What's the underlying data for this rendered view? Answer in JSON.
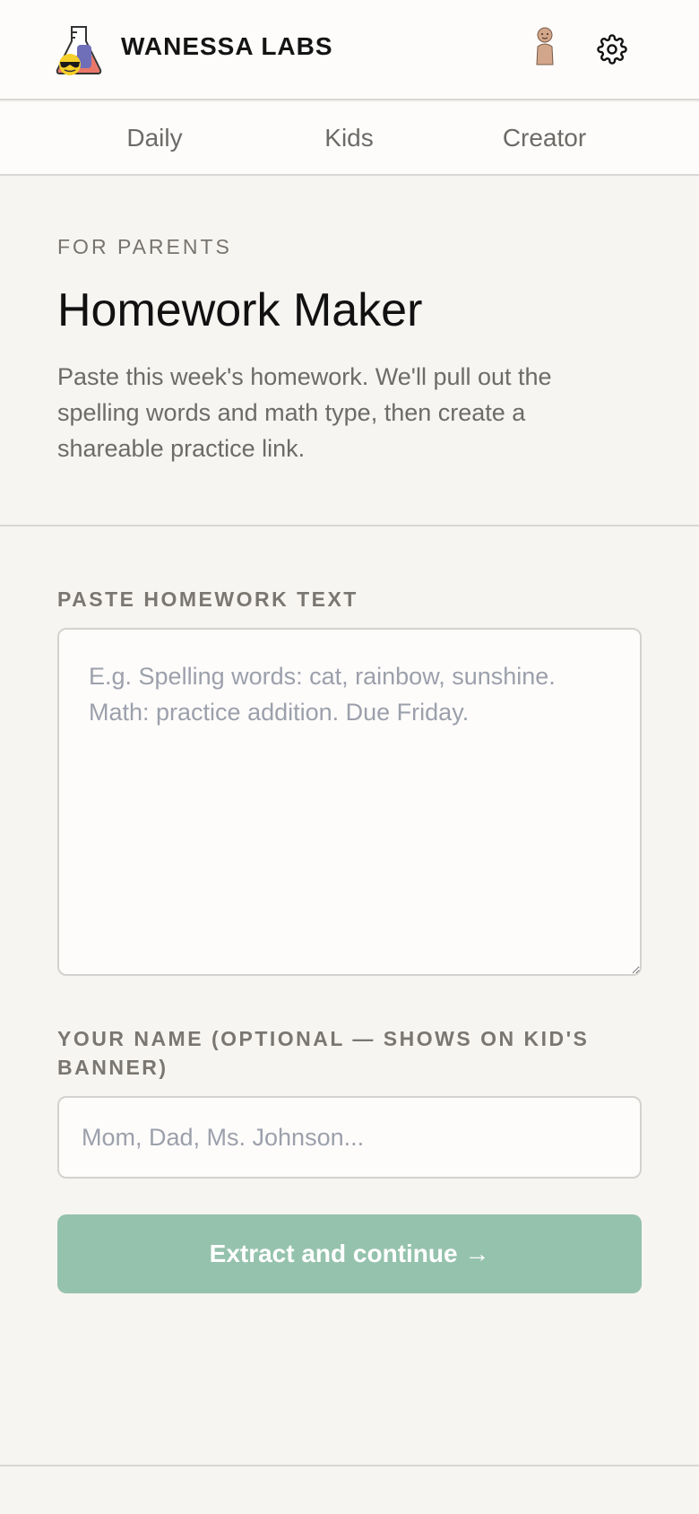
{
  "header": {
    "brand": "WANESSA LABS",
    "logo_icon": "flask-with-cool-emoji-icon",
    "avatar_icon": "person-avatar-icon",
    "settings_icon": "gear-icon"
  },
  "nav": {
    "items": [
      {
        "label": "Daily"
      },
      {
        "label": "Kids"
      },
      {
        "label": "Creator"
      }
    ]
  },
  "intro": {
    "eyebrow": "FOR PARENTS",
    "title": "Homework Maker",
    "description": "Paste this week's homework. We'll pull out the spelling words and math type, then create a shareable practice link."
  },
  "form": {
    "homework_label": "PASTE HOMEWORK TEXT",
    "homework_value": "",
    "homework_placeholder": "E.g. Spelling words: cat, rainbow, sunshine.\nMath: practice addition. Due Friday.",
    "name_label": "YOUR NAME (OPTIONAL — SHOWS ON KID'S BANNER)",
    "name_value": "",
    "name_placeholder": "Mom, Dad, Ms. Johnson...",
    "submit_label": "Extract and continue →"
  },
  "colors": {
    "background": "#f7f5f2",
    "surface": "#fdfcfb",
    "accent_button": "#95c2ad",
    "muted_text": "#6d6b67",
    "placeholder": "#9ca0ab"
  }
}
